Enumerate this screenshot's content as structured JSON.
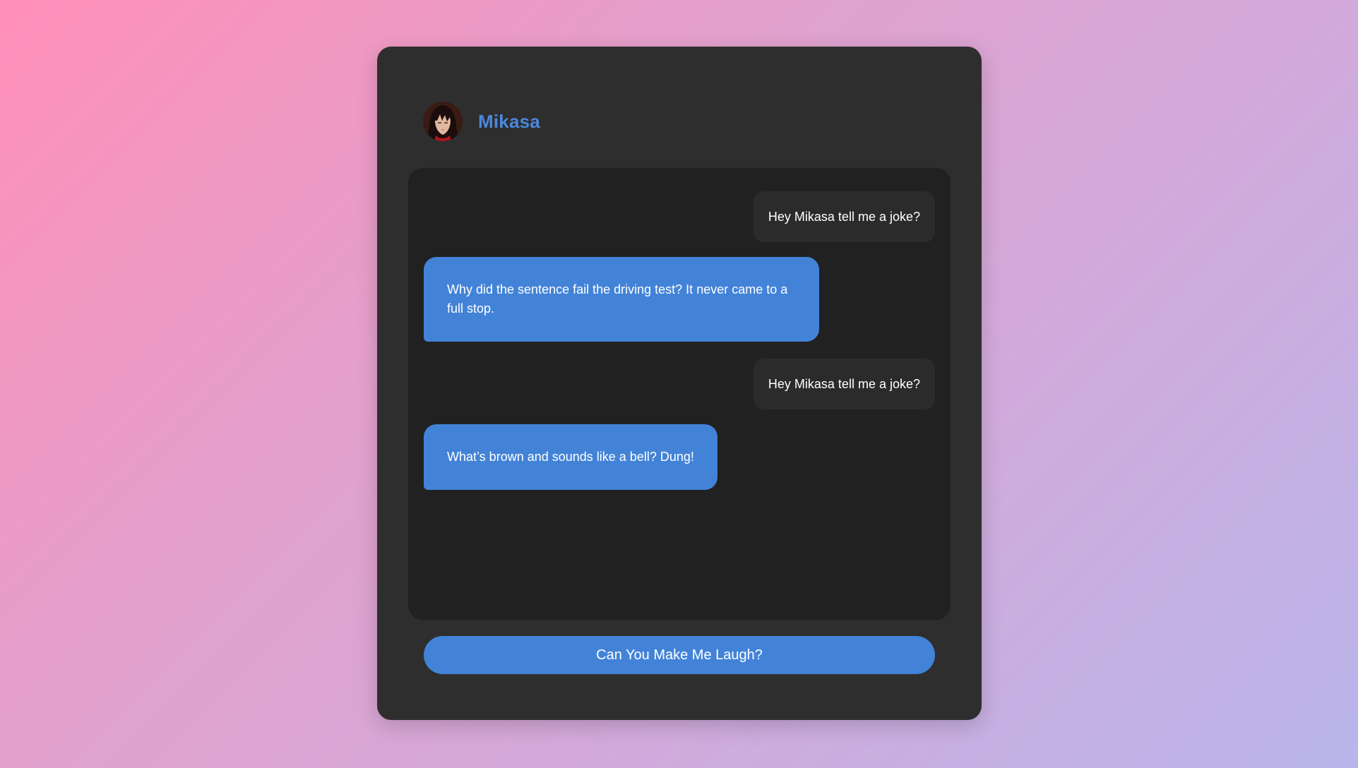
{
  "header": {
    "name": "Mikasa",
    "avatar_icon": "character-avatar"
  },
  "messages": [
    {
      "role": "user",
      "text": "Hey Mikasa tell me a joke?"
    },
    {
      "role": "bot",
      "text": "Why did the sentence fail the driving test? It never came to a full stop."
    },
    {
      "role": "user",
      "text": "Hey Mikasa tell me a joke?"
    },
    {
      "role": "bot",
      "text": "What’s brown and sounds like a bell? Dung!"
    }
  ],
  "action": {
    "label": "Can You Make Me Laugh?"
  },
  "colors": {
    "accent": "#4283d8",
    "card": "#2e2e2e",
    "chat_bg": "#212121",
    "user_bubble": "#2b2b2b"
  }
}
